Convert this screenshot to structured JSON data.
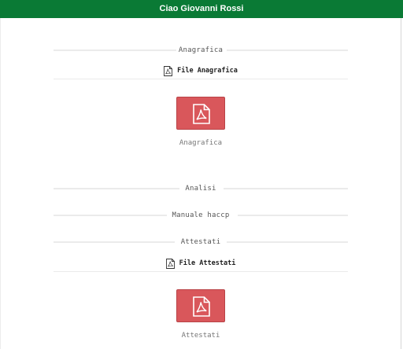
{
  "header": {
    "greeting": "Ciao Giovanni Rossi"
  },
  "sections": [
    {
      "title": "Anagrafica",
      "file_link": "File Anagrafica",
      "document_caption": "Anagrafica"
    },
    {
      "title": "Analisi"
    },
    {
      "title": "Manuale haccp"
    },
    {
      "title": "Attestati",
      "file_link": "File Attestati",
      "document_caption": "Attestati"
    }
  ],
  "colors": {
    "header_bg": "#0a7a35",
    "pdf_button_bg": "#d9575b"
  },
  "icons": {
    "file": "pdf-file-icon",
    "document_button": "pdf-icon"
  }
}
